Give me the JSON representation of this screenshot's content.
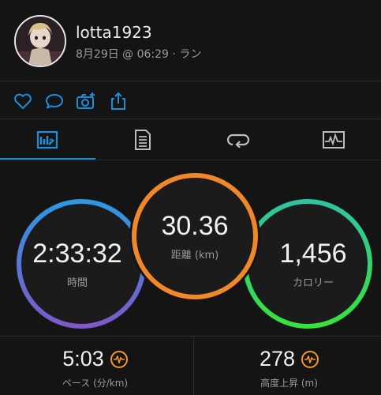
{
  "header": {
    "username": "lotta1923",
    "meta": "8月29日 @ 06:29 · ラン"
  },
  "actions": [
    {
      "icon": "heart-icon"
    },
    {
      "icon": "comment-icon"
    },
    {
      "icon": "add-photo-icon"
    },
    {
      "icon": "share-icon"
    }
  ],
  "tabs": [
    {
      "icon": "overview-icon",
      "active": true
    },
    {
      "icon": "details-icon",
      "active": false
    },
    {
      "icon": "laps-icon",
      "active": false
    },
    {
      "icon": "graphs-icon",
      "active": false
    }
  ],
  "rings": {
    "time": {
      "value": "2:33:32",
      "label": "時間"
    },
    "distance": {
      "value": "30.36",
      "label": "距離 (km)"
    },
    "calories": {
      "value": "1,456",
      "label": "カロリー"
    }
  },
  "stats": {
    "pace": {
      "value": "5:03",
      "label": "ペース (分/km)",
      "icon": "pace-chart-icon"
    },
    "elevation": {
      "value": "278",
      "label": "高度上昇 (m)",
      "icon": "elevation-chart-icon"
    }
  },
  "colors": {
    "accent": "#1c8fd8",
    "time_ring": "#7a5cd0",
    "distance_ring": "#f0872a",
    "calories_ring": "#2ed84a",
    "badge": "#f19a2a"
  }
}
